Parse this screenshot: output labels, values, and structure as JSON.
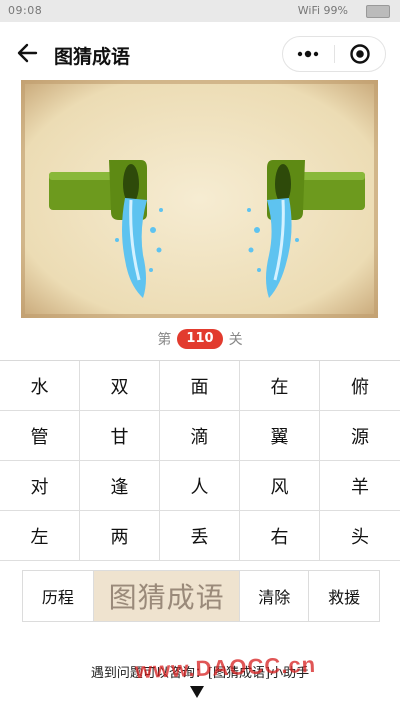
{
  "status_bar": {
    "time": "09:08",
    "signal": "WiFi 99%"
  },
  "nav": {
    "title": "图猜成语",
    "back_icon": "arrow-left-icon",
    "more_icon": "more-dots-icon",
    "close_icon": "target-circle-icon"
  },
  "level": {
    "prefix": "第",
    "number": "110",
    "suffix": "关"
  },
  "keyboard": {
    "rows": [
      [
        "水",
        "双",
        "面",
        "在",
        "俯"
      ],
      [
        "管",
        "甘",
        "滴",
        "翼",
        "源"
      ],
      [
        "对",
        "逢",
        "人",
        "风",
        "羊"
      ],
      [
        "左",
        "两",
        "丢",
        "右",
        "头"
      ]
    ]
  },
  "actions": {
    "history": "历程",
    "logo": "图猜成语",
    "clear": "清除",
    "rescue": "救援"
  },
  "footer": {
    "text": "遇到问题可以咨询：[图猜成语]小助手",
    "watermark": "www.DAOCC.cn"
  },
  "colors": {
    "accent_red": "#e23b2e",
    "pipe_green": "#6d9a1e",
    "water_blue": "#5ec3f0",
    "parchment": "#f0e3c3"
  }
}
